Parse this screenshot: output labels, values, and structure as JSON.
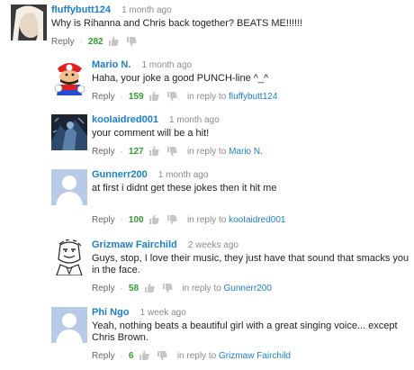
{
  "comments": [
    {
      "author": "fluffybutt124",
      "time": "1 month ago",
      "text": "Why is Rihanna and Chris back together? BEATS ME!!!!!!",
      "reply_label": "Reply",
      "separator": "·",
      "score": "282",
      "in_reply_to_prefix": "",
      "in_reply_to": ""
    },
    {
      "author": "Mario N.",
      "time": "1 month ago",
      "text": "Haha, your joke a good PUNCH-line ^_^",
      "reply_label": "Reply",
      "separator": "·",
      "score": "159",
      "in_reply_to_prefix": "in reply to",
      "in_reply_to": "fluffybutt124"
    },
    {
      "author": "kooIaidred001",
      "time": "1 month ago",
      "text": "your comment will be a hit!",
      "reply_label": "Reply",
      "separator": "·",
      "score": "127",
      "in_reply_to_prefix": "in reply to",
      "in_reply_to": "Mario N."
    },
    {
      "author": "Gunnerr200",
      "time": "1 month ago",
      "text": "at first i didnt get these jokes then it hit me",
      "reply_label": "Reply",
      "separator": "·",
      "score": "100",
      "in_reply_to_prefix": "in reply to",
      "in_reply_to": "kooIaidred001"
    },
    {
      "author": "Grizmaw Fairchild",
      "time": "2 weeks ago",
      "text": "Guys, stop, I love their music, they just have that sound that smacks you in the face.",
      "reply_label": "Reply",
      "separator": "·",
      "score": "58",
      "in_reply_to_prefix": "in reply to",
      "in_reply_to": "Gunnerr200"
    },
    {
      "author": "Phi Ngo",
      "time": "1 week ago",
      "text": "Yeah, nothing beats a beautiful girl with a great singing voice... except Chris Brown.",
      "reply_label": "Reply",
      "separator": "·",
      "score": "6",
      "in_reply_to_prefix": "in reply to",
      "in_reply_to": "Grizmaw Fairchild"
    }
  ],
  "icons": {
    "like": "thumbs-up-icon",
    "dislike": "thumbs-down-icon",
    "default_avatar": "default-user-avatar-icon"
  },
  "colors": {
    "link_blue": "#1b7fcc",
    "score_green": "#2f9e2f",
    "meta_gray": "#8a8a8a",
    "default_avatar_bg": "#b7cbe7"
  }
}
